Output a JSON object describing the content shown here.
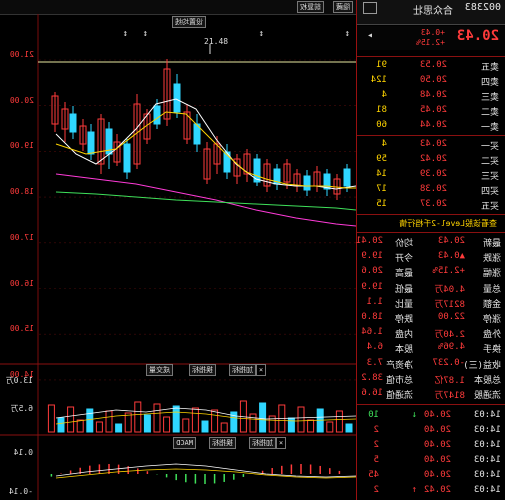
{
  "header": {
    "code": "002383",
    "name": "合众思壮",
    "price": "20.43",
    "change": "+0.43",
    "change_pct": "+2.15%"
  },
  "sell_label": "卖",
  "buy_label": "买",
  "sell": [
    {
      "label": "卖五",
      "price": "20.53",
      "vol": "91"
    },
    {
      "label": "卖四",
      "price": "20.50",
      "vol": "124"
    },
    {
      "label": "卖三",
      "price": "20.48",
      "vol": "4"
    },
    {
      "label": "卖二",
      "price": "20.45",
      "vol": "81"
    },
    {
      "label": "卖一",
      "price": "20.44",
      "vol": "60"
    }
  ],
  "buy": [
    {
      "label": "买一",
      "price": "20.43",
      "vol": "4"
    },
    {
      "label": "买二",
      "price": "20.42",
      "vol": "59"
    },
    {
      "label": "买三",
      "price": "20.39",
      "vol": "14"
    },
    {
      "label": "买四",
      "price": "20.38",
      "vol": "17"
    },
    {
      "label": "买五",
      "price": "20.37",
      "vol": "15"
    }
  ],
  "level2_link": "查看该股Level-2千档行情",
  "stats": [
    {
      "l1": "最新",
      "v1": "20.43",
      "l2": "均价",
      "v2": "20.41"
    },
    {
      "l1": "涨跌",
      "v1": "▲0.43",
      "l2": "今开",
      "v2": "19.9"
    },
    {
      "l1": "涨幅",
      "v1": "+2.15%",
      "l2": "最高",
      "v2": "20.6"
    },
    {
      "l1": "总量",
      "v1": "4.04万",
      "l2": "最低",
      "v2": "19.9"
    },
    {
      "l1": "金额",
      "v1": "8217万",
      "l2": "量比",
      "v2": "1.1"
    },
    {
      "l1": "涨停",
      "v1": "22.00",
      "l2": "跌停",
      "v2": "18.0"
    },
    {
      "l1": "外盘",
      "v1": "2.40万",
      "l2": "内盘",
      "v2": "1.64"
    },
    {
      "l1": "换手",
      "v1": "4.96%",
      "l2": "股本",
      "v2": "6.4"
    },
    {
      "l1": "收益(三)",
      "v1": "-0.237",
      "l2": "净资产",
      "v2": "7.3"
    },
    {
      "l1": "总股本",
      "v1": "1.87亿",
      "l2": "总市值",
      "v2": "38.2"
    },
    {
      "l1": "流通股",
      "v1": "8147万",
      "l2": "流通值",
      "v2": "16.6"
    }
  ],
  "ticks": [
    {
      "t": "14:03",
      "p": "20.40",
      "v": "10",
      "arrow": "↓"
    },
    {
      "t": "14:03",
      "p": "20.40",
      "v": "2",
      "arrow": ""
    },
    {
      "t": "14:03",
      "p": "20.40",
      "v": "2",
      "arrow": ""
    },
    {
      "t": "14:03",
      "p": "20.40",
      "v": "5",
      "arrow": ""
    },
    {
      "t": "14:03",
      "p": "20.40",
      "v": "45",
      "arrow": ""
    },
    {
      "t": "14:03",
      "p": "20.42",
      "v": "2",
      "arrow": "↑"
    }
  ],
  "toolbar": {
    "hide": "隐藏",
    "adjust": "前复权",
    "settings": "设置均线"
  },
  "chart": {
    "y_ticks": [
      "21.00",
      "20.00",
      "19.00",
      "18.00",
      "17.00",
      "16.00",
      "15.00",
      "14.00"
    ],
    "high_label": "21.48",
    "vol_label_top": "13.0万",
    "vol_label_mid": "6.5万",
    "macd_label": "0.14",
    "macd_label_neg": "-0.14",
    "btn_vol": "成交量",
    "btn_add": "加指标",
    "btn_change": "换指标",
    "btn_macd": "MACD"
  }
}
